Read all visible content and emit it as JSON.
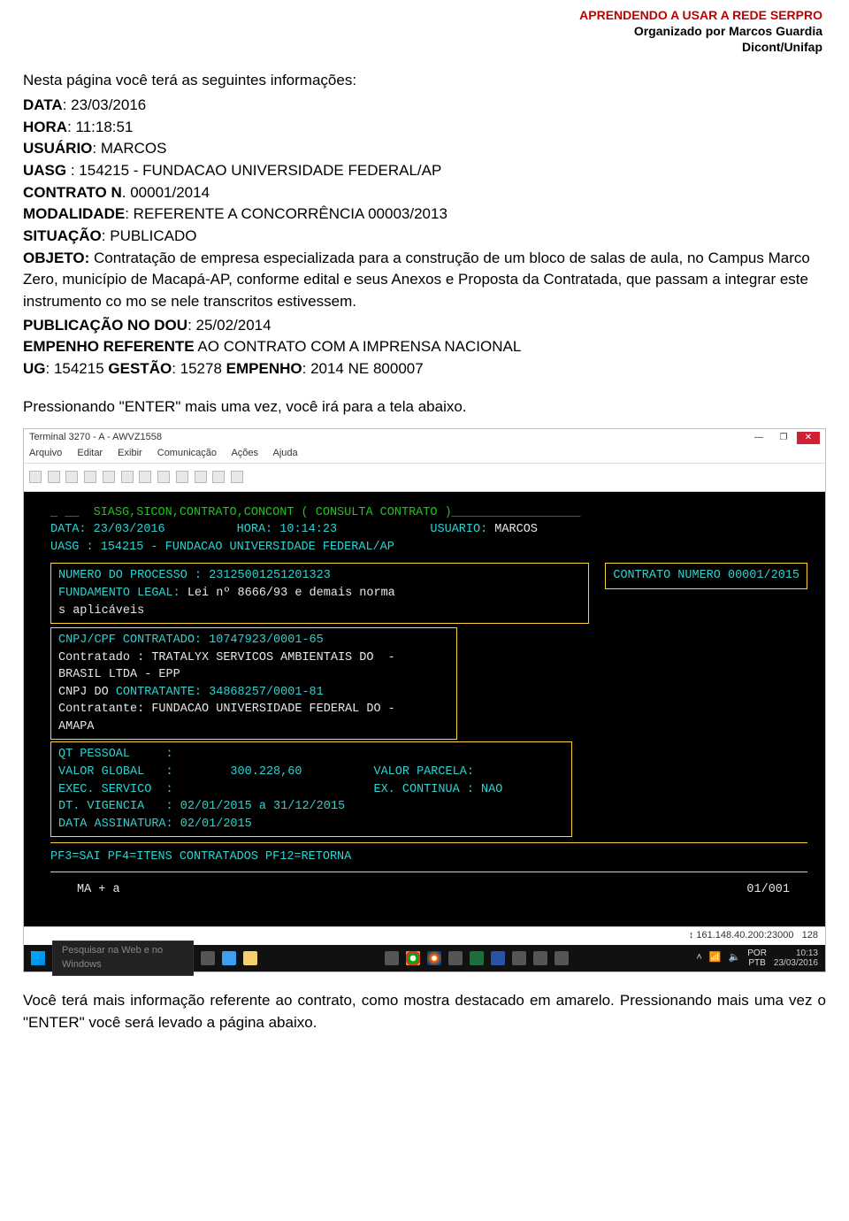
{
  "header": {
    "title_red": "APRENDENDO A USAR A REDE SERPRO",
    "line2": "Organizado por Marcos Guardia",
    "line3": "Dicont/Unifap"
  },
  "intro": "Nesta página você terá as seguintes informações:",
  "fields": {
    "data_label": "DATA",
    "data_value": ": 23/03/2016",
    "hora_label": "HORA",
    "hora_value": ": 11:18:51",
    "usuario_label": "USUÁRIO",
    "usuario_value": ": MARCOS",
    "uasg_label": "UASG ",
    "uasg_value": ": 154215 - FUNDACAO UNIVERSIDADE FEDERAL/AP",
    "contrato_label": "CONTRATO  N",
    "contrato_value": ". 00001/2014",
    "modalidade_label": "MODALIDADE",
    "modalidade_value": ": REFERENTE A CONCORRÊNCIA     00003/2013",
    "situacao_label": "SITUAÇÃO",
    "situacao_value": ": PUBLICADO",
    "objeto_label": "OBJETO:",
    "objeto_value": " Contratação de empresa especializada para a construção de um bloco de salas de aula, no Campus Marco Zero, município de Macapá-AP, conforme edital e seus Anexos e Proposta da Contratada, que passam a integrar este instrumento co mo se nele transcritos estivessem.",
    "pub_label": " PUBLICAÇÃO NO DOU",
    "pub_value": ": 25/02/2014",
    "empenho_ref_label": "EMPENHO REFERENTE",
    "empenho_ref_value": " AO CONTRATO COM A IMPRENSA NACIONAL",
    "ug_label": "UG",
    "ug_value": ": 154215    ",
    "gestao_label": "GESTÃO",
    "gestao_value": ": 15278    ",
    "empenho_label": "EMPENHO",
    "empenho_value": ": 2014 NE 800007"
  },
  "result_line": "Pressionando \"ENTER\" mais uma vez, você irá para a tela abaixo.",
  "terminal": {
    "window_title": "Terminal 3270 - A - AWVZ1558",
    "menu": [
      "Arquivo",
      "Editar",
      "Exibir",
      "Comunicação",
      "Ações",
      "Ajuda"
    ],
    "header_line": "_ __  SIASG,SICON,CONTRATO,CONCONT ( CONSULTA CONTRATO )__________________",
    "data_line_left": "DATA: 23/03/2016          HORA: 10:14:23",
    "usuario_label": "USUARIO:",
    "usuario_value": " MARCOS",
    "uasg_line": "UASG : 154215 - FUNDACAO UNIVERSIDADE FEDERAL/AP",
    "box1_left_l1": "NUMERO DO PROCESSO : 23125001251201323",
    "box1_left_l2a": "FUNDAMENTO LEGAL:",
    "box1_left_l2b": " Lei nº 8666/93 e demais norma",
    "box1_left_l3": "s aplicáveis",
    "box1_right": "CONTRATO NUMERO 00001/2015",
    "box2_l1": "CNPJ/CPF CONTRATADO: 10747923/0001-65",
    "box2_l2": "Contratado : TRATALYX SERVICOS AMBIENTAIS DO  -",
    "box2_l3": "BRASIL LTDA - EPP",
    "box2_l4": "CNPJ DO CONTRATANTE: 34868257/0001-81",
    "box2_l5": "Contratante: FUNDACAO UNIVERSIDADE FEDERAL DO -",
    "box2_l6": "AMAPA",
    "box3_l1": "QT PESSOAL     :",
    "box3_l2_left": "VALOR GLOBAL   :        300.228,60",
    "box3_l2_right": "VALOR PARCELA:",
    "box3_l3_left": "EXEC. SERVICO  :",
    "box3_l3_right": "EX. CONTINUA : NAO",
    "box3_l4": "DT. VIGENCIA   : 02/01/2015 a 31/12/2015",
    "box3_l5": "DATA ASSINATURA: 02/01/2015",
    "pf_line": "PF3=SAI PF4=ITENS CONTRATADOS PF12=RETORNA",
    "status_left": "MA  +    a",
    "status_right": "01/001",
    "conn_status": "161.148.40.200:23000",
    "conn_num": "128",
    "search_placeholder": "Pesquisar na Web e no Windows",
    "lang1": "POR",
    "lang2": "PTB",
    "clock_time": "10:13",
    "clock_date": "23/03/2016"
  },
  "final_para": "Você terá mais informação referente ao contrato, como mostra destacado em amarelo. Pressionando mais uma vez o \"ENTER\" você será levado a página abaixo."
}
